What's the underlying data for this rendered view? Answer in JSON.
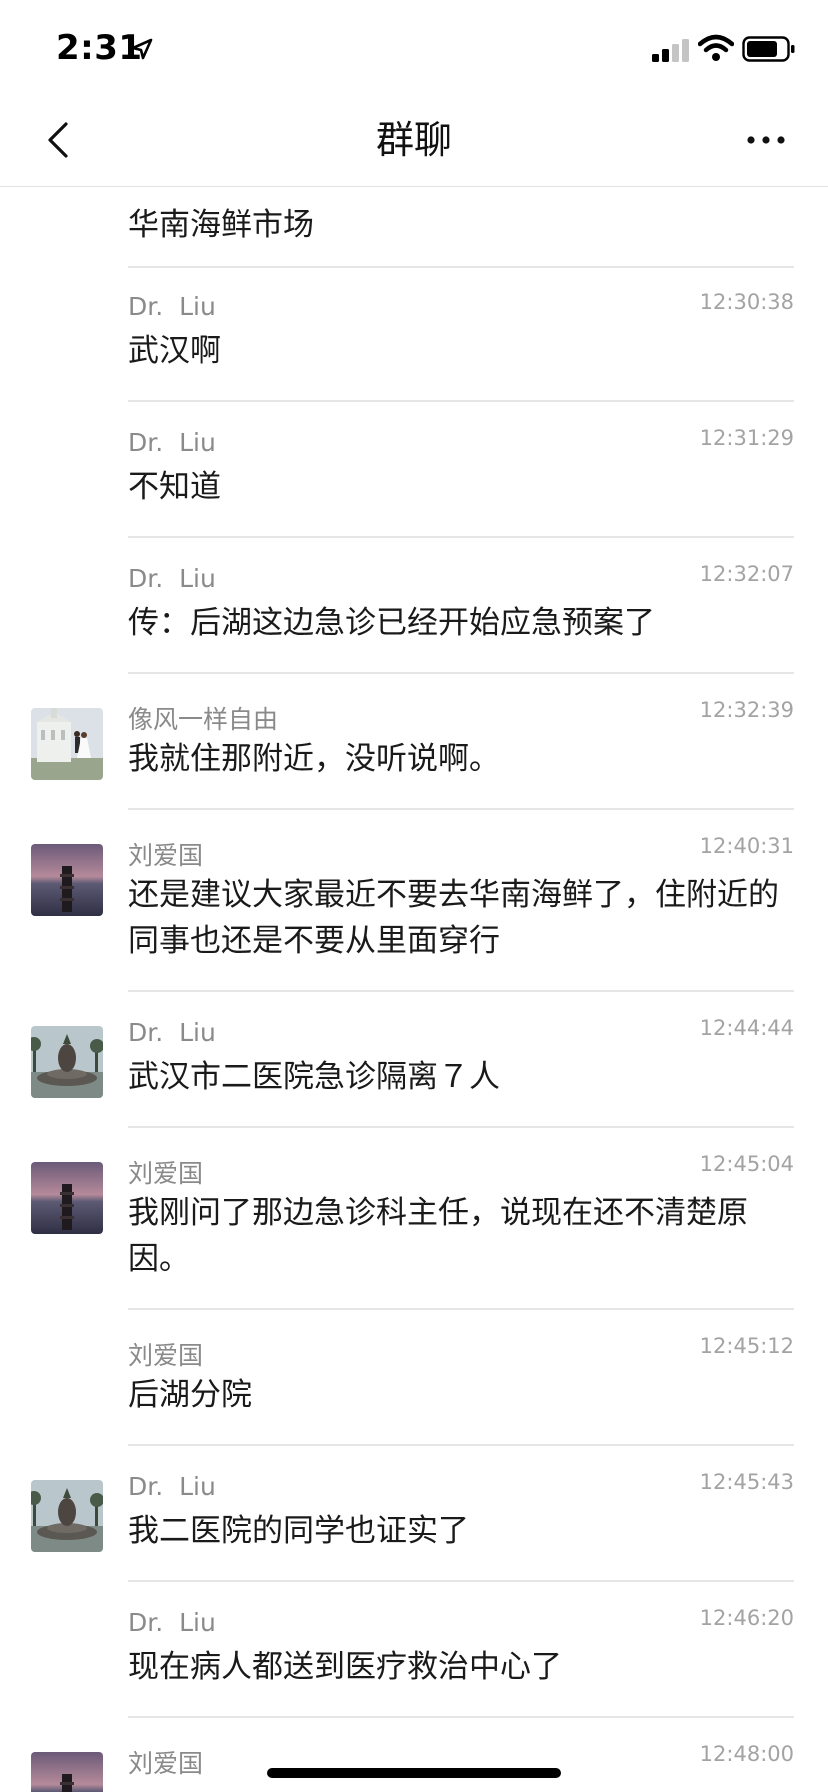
{
  "status_bar": {
    "time": "2:31",
    "location_icon": "location-arrow-icon",
    "signal_icon": "cellular-signal-icon",
    "wifi_icon": "wifi-icon",
    "battery_icon": "battery-icon"
  },
  "nav": {
    "title": "群聊",
    "back_icon": "chevron-left-icon",
    "more_icon": "more-dots-icon"
  },
  "first_message": {
    "text": "华南海鲜市场"
  },
  "messages": [
    {
      "sender": "Dr.  Liu",
      "time": "12:30:38",
      "text": "武汉啊",
      "avatar": ""
    },
    {
      "sender": "Dr.  Liu",
      "time": "12:31:29",
      "text": "不知道",
      "avatar": ""
    },
    {
      "sender": "Dr.  Liu",
      "time": "12:32:07",
      "text": "传：后湖这边急诊已经开始应急预案了",
      "avatar": ""
    },
    {
      "sender": "像风一样自由",
      "time": "12:32:39",
      "text": "我就住那附近，没听说啊。",
      "avatar": "wedding-photo"
    },
    {
      "sender": "刘爱国",
      "time": "12:40:31",
      "text": "还是建议大家最近不要去华南海鲜了，住附近的同事也还是不要从里面穿行",
      "avatar": "seascape-photo"
    },
    {
      "sender": "Dr.  Liu",
      "time": "12:44:44",
      "text": "武汉市二医院急诊隔离７人",
      "avatar": "fountain-photo"
    },
    {
      "sender": "刘爱国",
      "time": "12:45:04",
      "text": "我刚问了那边急诊科主任，说现在还不清楚原因。",
      "avatar": "seascape-photo"
    },
    {
      "sender": "刘爱国",
      "time": "12:45:12",
      "text": "后湖分院",
      "avatar": ""
    },
    {
      "sender": "Dr.  Liu",
      "time": "12:45:43",
      "text": "我二医院的同学也证实了",
      "avatar": "fountain-photo"
    },
    {
      "sender": "Dr.  Liu",
      "time": "12:46:20",
      "text": "现在病人都送到医疗救治中心了",
      "avatar": ""
    },
    {
      "sender": "刘爱国",
      "time": "12:48:00",
      "text": "",
      "avatar": "seascape-photo"
    }
  ],
  "colors": {
    "sender": "#8a8a8a",
    "timestamp": "#a3a3a3",
    "text": "#1a1a1a",
    "divider": "#e6e6e6"
  }
}
